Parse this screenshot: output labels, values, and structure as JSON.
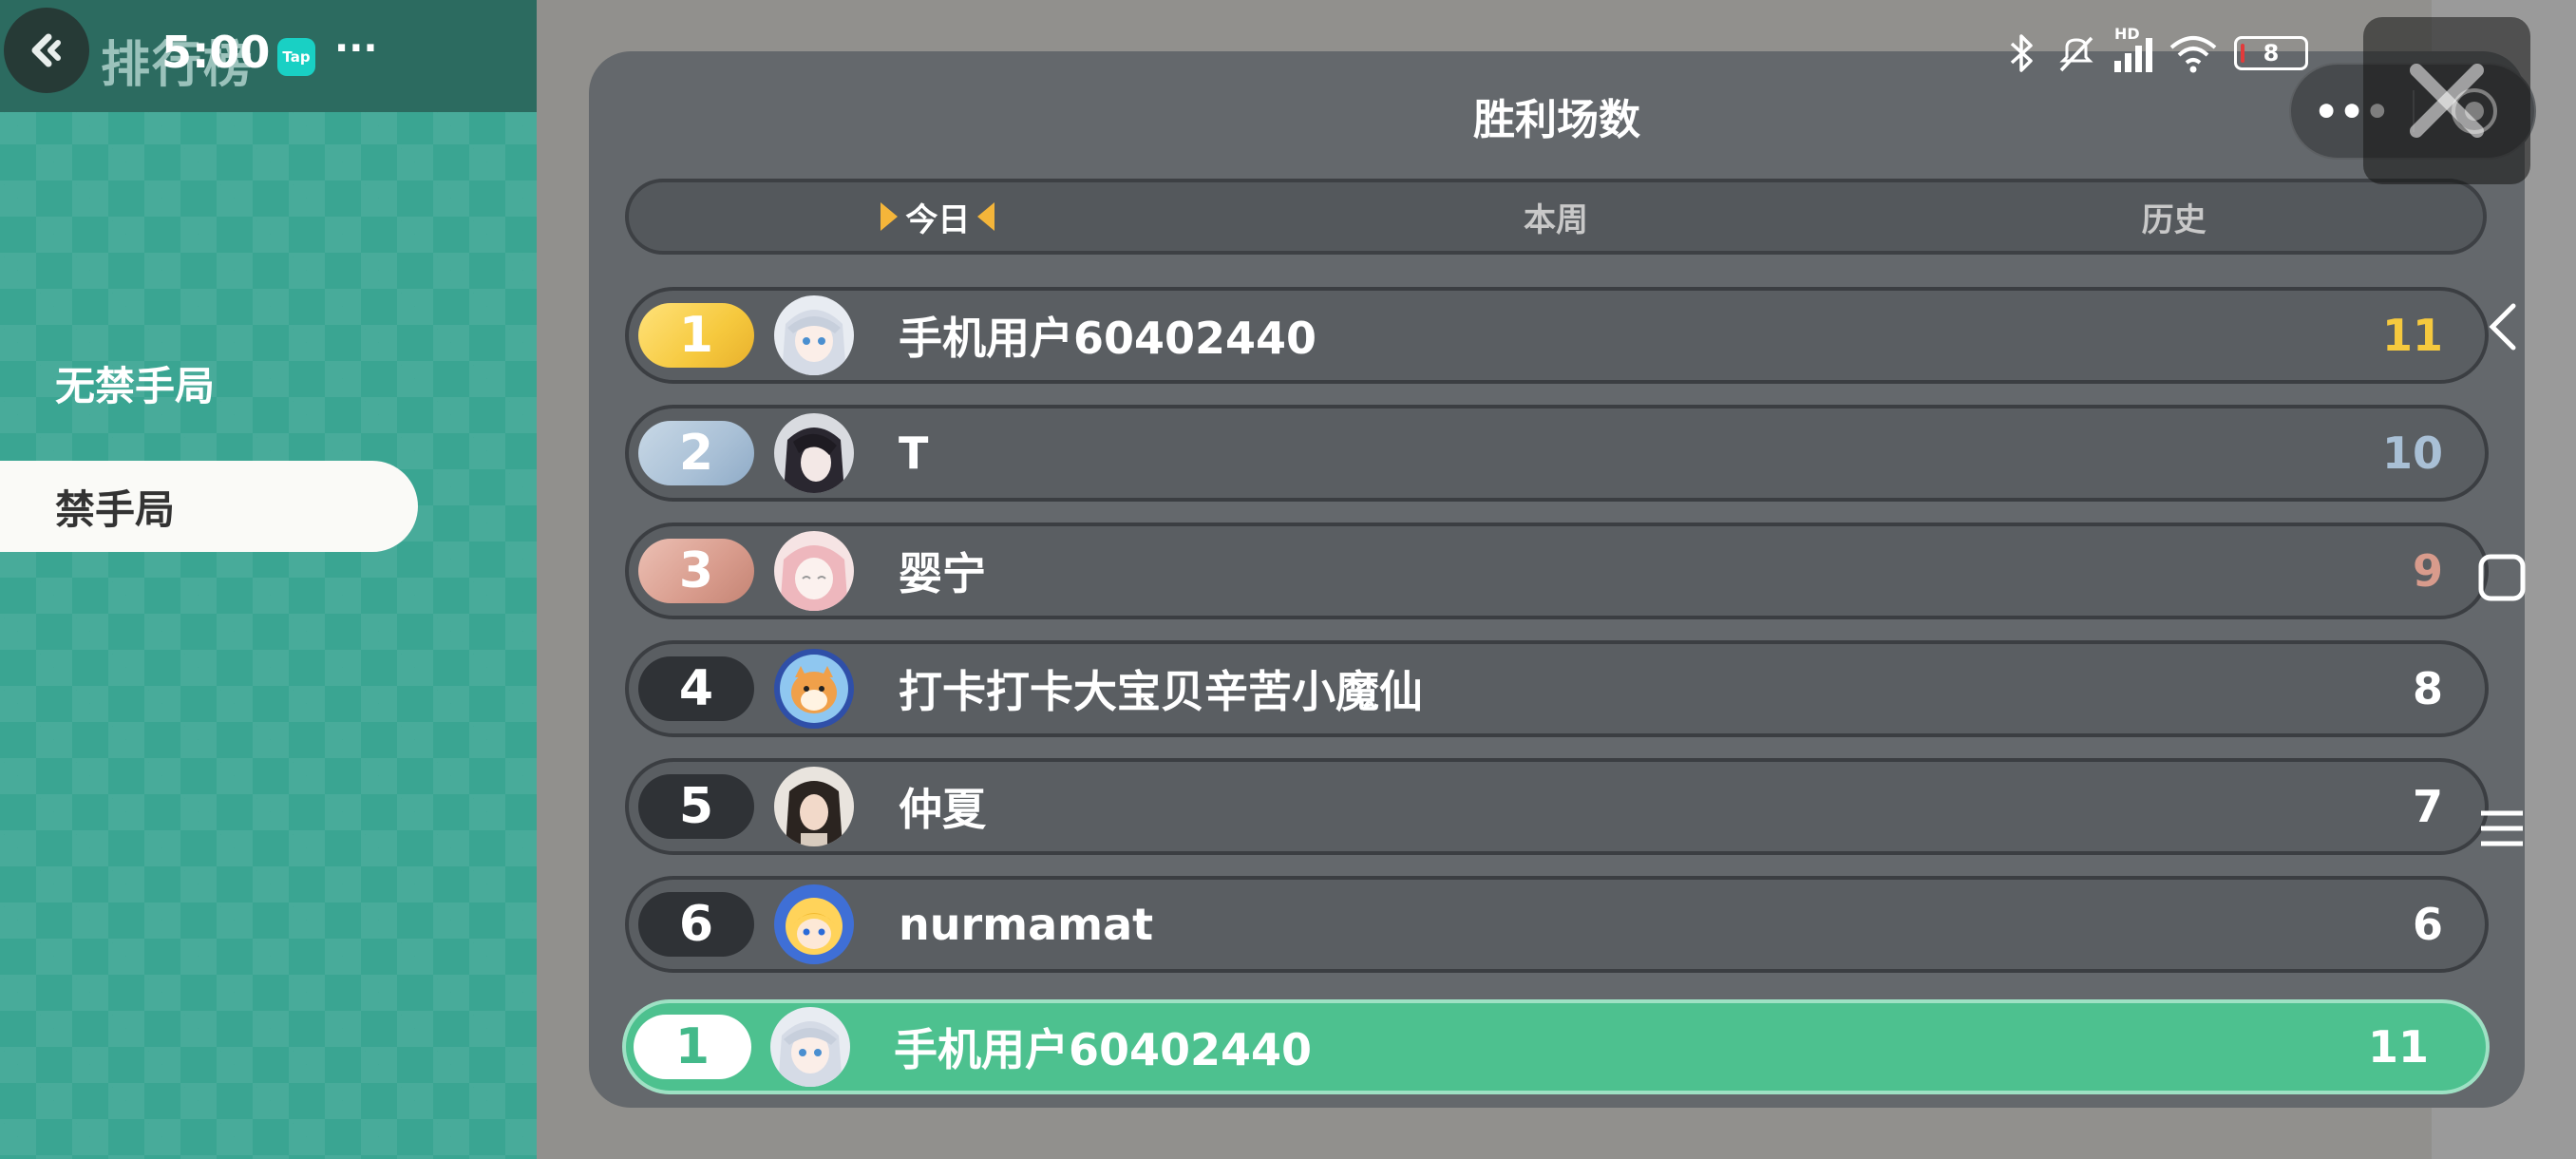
{
  "status_bar": {
    "time": "5:00",
    "app_badge": "Tap",
    "more": "···",
    "battery": "8",
    "network_label": "HD"
  },
  "header": {
    "page_title": "排行榜"
  },
  "sidebar": {
    "modes": [
      {
        "label": "无禁手局",
        "selected": false
      },
      {
        "label": "禁手局",
        "selected": true
      }
    ]
  },
  "leaderboard": {
    "title": "胜利场数",
    "tabs": [
      {
        "label": "今日",
        "active": true
      },
      {
        "label": "本周",
        "active": false
      },
      {
        "label": "历史",
        "active": false
      }
    ],
    "rows": [
      {
        "rank": "1",
        "name": "手机用户60402440",
        "score": "11",
        "tier": "gold",
        "avatar": "anime-girl-white-hair-avatar"
      },
      {
        "rank": "2",
        "name": "T",
        "score": "10",
        "tier": "silver",
        "avatar": "dark-hair-anime-avatar"
      },
      {
        "rank": "3",
        "name": "婴宁",
        "score": "9",
        "tier": "bronze",
        "avatar": "pink-hair-anime-avatar"
      },
      {
        "rank": "4",
        "name": "打卡打卡大宝贝辛苦小魔仙",
        "score": "8",
        "tier": "normal",
        "avatar": "shiba-dog-avatar"
      },
      {
        "rank": "5",
        "name": "仲夏",
        "score": "7",
        "tier": "normal",
        "avatar": "photo-girl-avatar"
      },
      {
        "rank": "6",
        "name": "nurmamat",
        "score": "6",
        "tier": "normal",
        "avatar": "blonde-anime-avatar"
      }
    ],
    "my_rank": {
      "rank": "1",
      "name": "手机用户60402440",
      "score": "11",
      "avatar": "anime-girl-white-hair-avatar"
    }
  },
  "capsule": {
    "more": "•••"
  },
  "colors": {
    "sidebar_green": "#3aa592",
    "my_row_green": "#4dc18f",
    "gold": "#f6c93e",
    "silver": "#a9c0d6",
    "bronze": "#d89b8c",
    "panel_gray": "#64686c"
  }
}
